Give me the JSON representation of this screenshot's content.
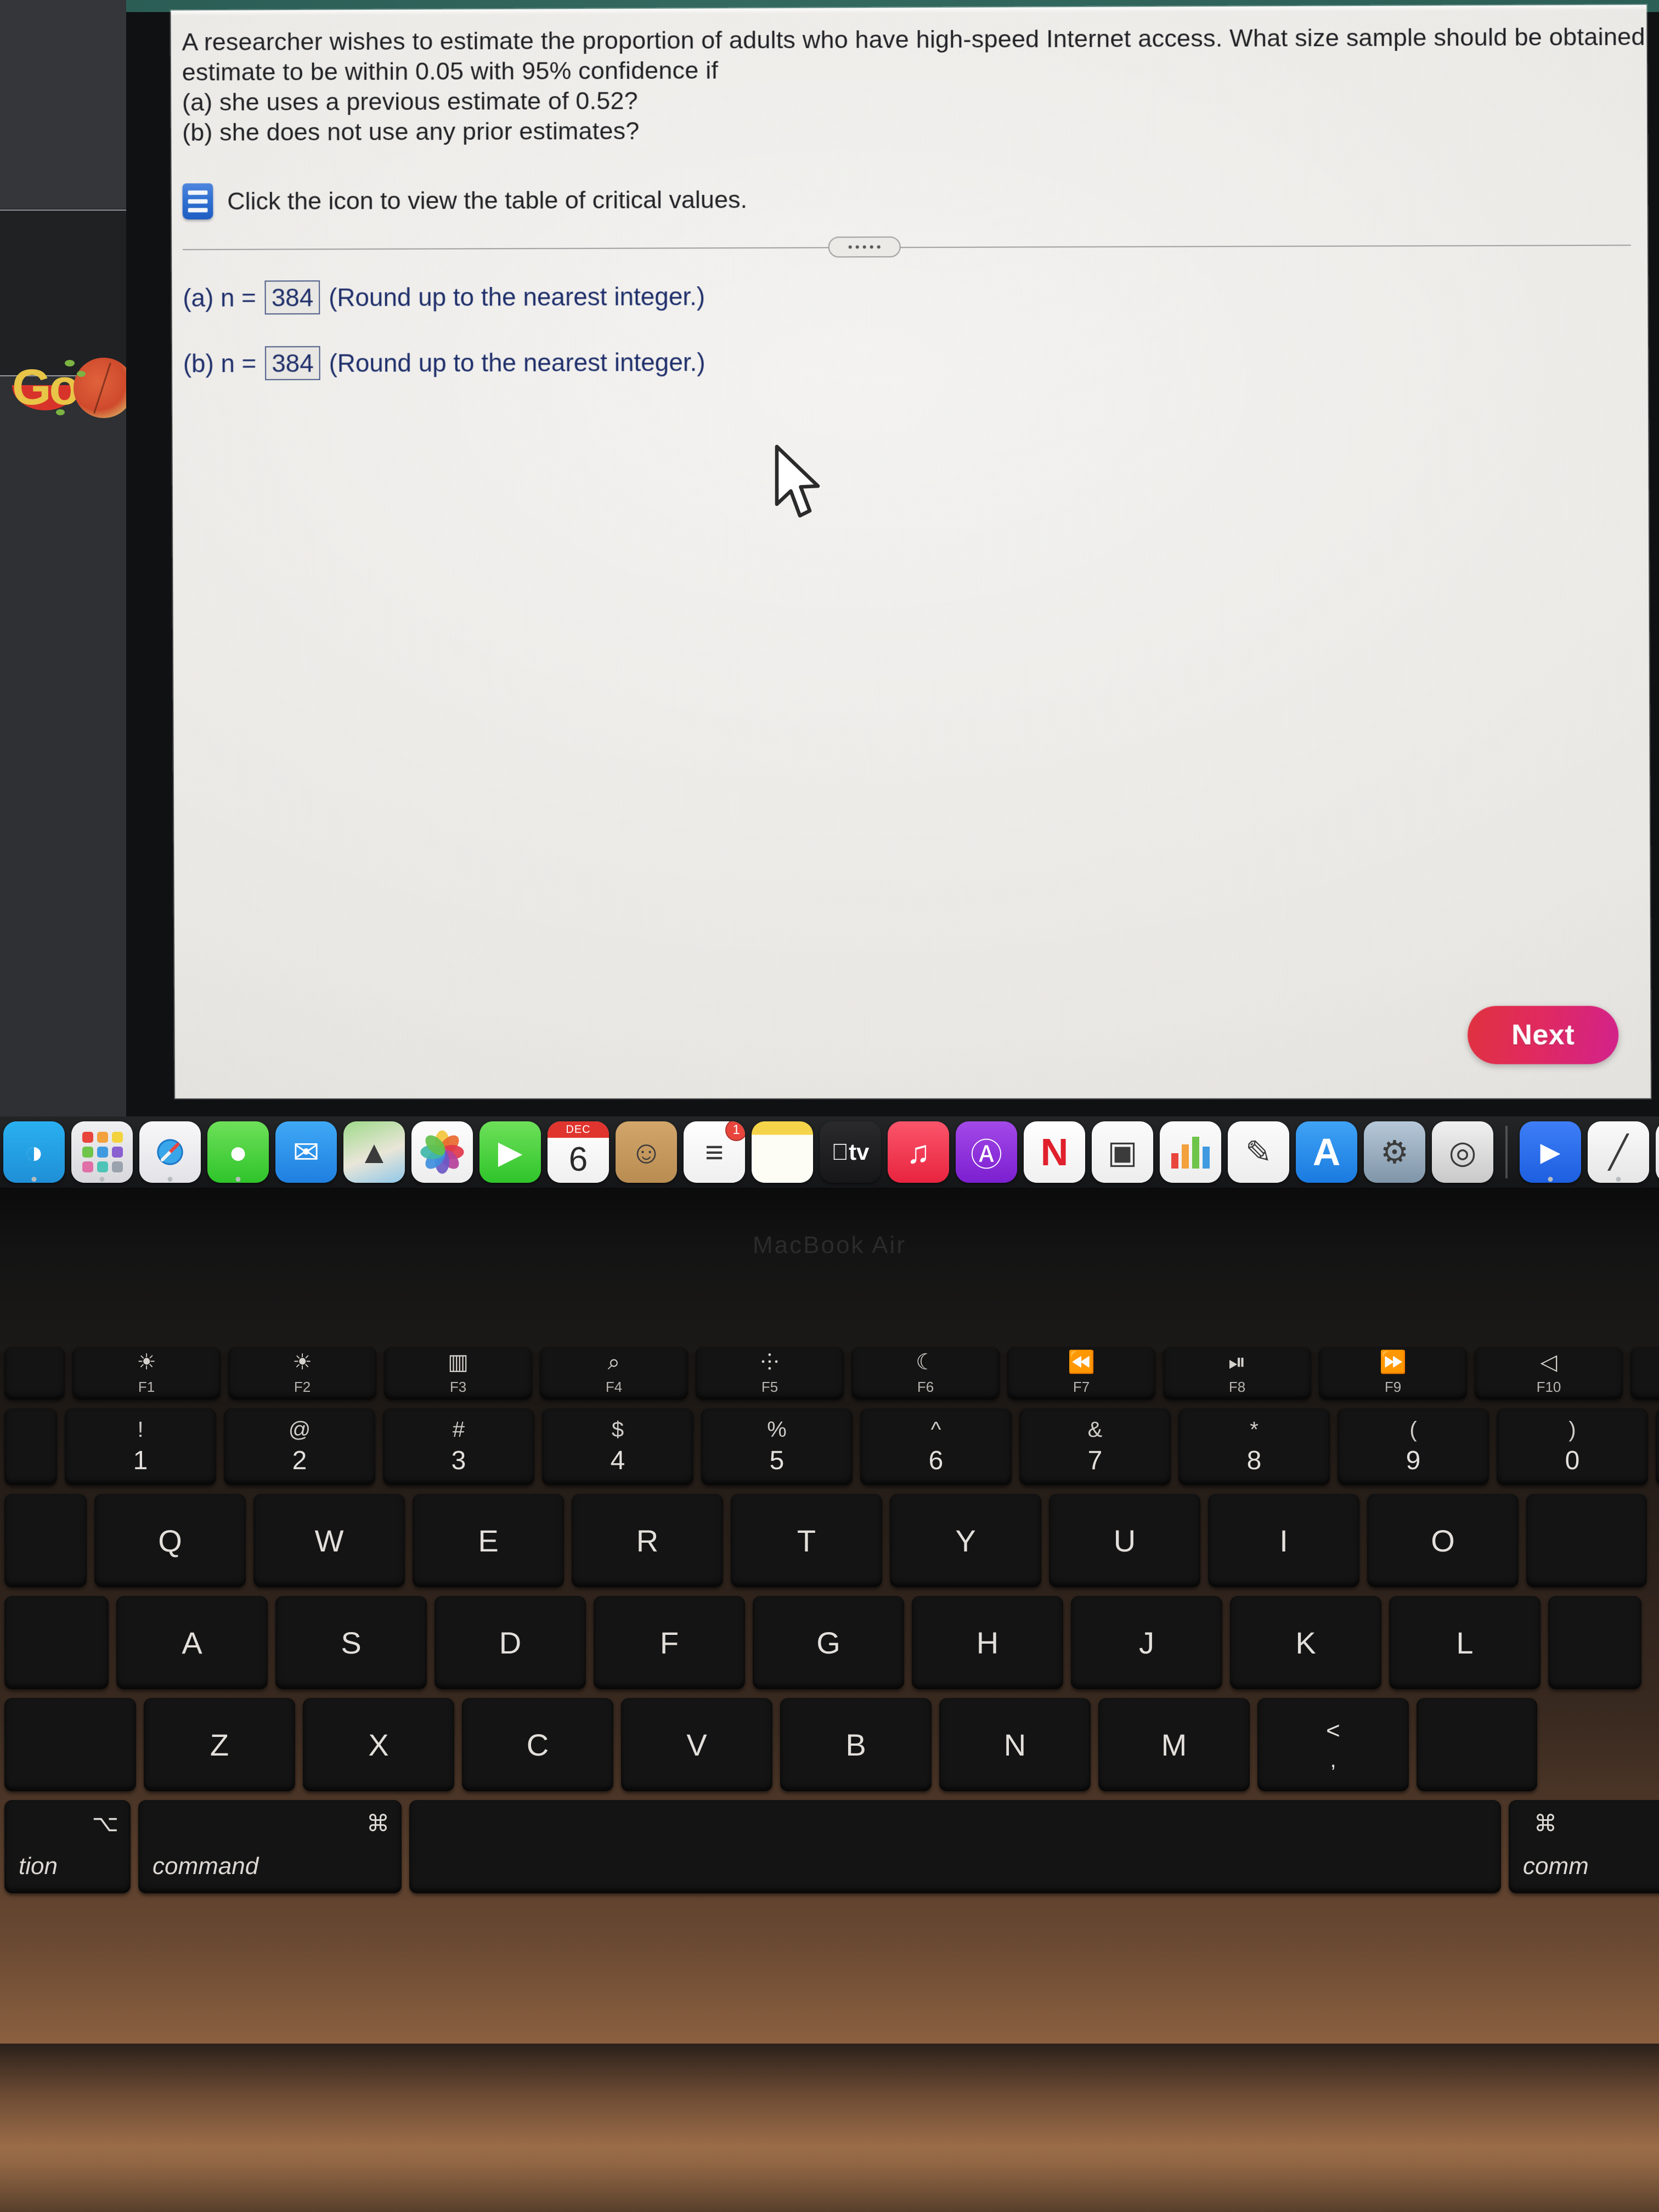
{
  "question": {
    "lines": [
      "A researcher wishes to estimate the proportion of adults who have high-speed Internet access. What size sample should be obtained if she wishes the",
      "estimate to be within 0.05 with 95% confidence if",
      "(a) she uses a previous estimate of 0.52?",
      "(b) she does not use any prior estimates?"
    ],
    "icon_hint": "Click the icon to view the table of critical values.",
    "divider_dots": "....."
  },
  "answers": [
    {
      "lead": "(a) n =",
      "value": "384",
      "tail": "(Round up to the nearest integer.)"
    },
    {
      "lead": "(b) n =",
      "value": "384",
      "tail": "(Round up to the nearest integer.)"
    }
  ],
  "next_button": {
    "label": "Next",
    "color": "#e02a5e"
  },
  "bg_window": {
    "logo_text": "Go"
  },
  "dock": {
    "items": [
      {
        "name": "finder",
        "glyph": "◑",
        "bg": "linear-gradient(180deg,#29b0f0,#1f8fd6)"
      },
      {
        "name": "launchpad",
        "glyph": "▓",
        "bg": "linear-gradient(180deg,#f0f0f2,#d8d8dc)"
      },
      {
        "name": "safari",
        "glyph": "✦",
        "bg": "linear-gradient(180deg,#f7f7f9,#e3e3e7)"
      },
      {
        "name": "messages",
        "glyph": "●",
        "bg": "linear-gradient(180deg,#6ee05a,#2fc42a)"
      },
      {
        "name": "mail",
        "glyph": "✉",
        "bg": "linear-gradient(180deg,#3fa9f5,#1f7fe0)"
      },
      {
        "name": "maps",
        "glyph": "▲",
        "bg": "linear-gradient(160deg,#9fd98a,#e9e6d8 55%,#8fc7e8)"
      },
      {
        "name": "photos",
        "glyph": "✿",
        "bg": "linear-gradient(180deg,#fdfdfd,#ededed)"
      },
      {
        "name": "facetime",
        "glyph": "▶",
        "bg": "linear-gradient(180deg,#6ee05a,#2fc42a)"
      },
      {
        "name": "calendar",
        "glyph": "6",
        "bg": "linear-gradient(180deg,#ffffff,#f0f0f0)",
        "top_label": "DEC"
      },
      {
        "name": "contacts",
        "glyph": "☺",
        "bg": "linear-gradient(180deg,#d2a66a,#b98c52)"
      },
      {
        "name": "reminders",
        "glyph": "≡",
        "bg": "linear-gradient(180deg,#ffffff,#efefef)",
        "badge": "1"
      },
      {
        "name": "notes",
        "glyph": "",
        "bg": "linear-gradient(180deg,#f6d44a 0 22%,#fdfdf6 22%)"
      },
      {
        "name": "appletv",
        "glyph": "tv",
        "bg": "linear-gradient(180deg,#2a2a2c,#171719)"
      },
      {
        "name": "music",
        "glyph": "♫",
        "bg": "linear-gradient(180deg,#fb556b,#e8243f)"
      },
      {
        "name": "podcasts",
        "glyph": "Ⓐ",
        "bg": "linear-gradient(180deg,#a349e8,#7b1fd0)"
      },
      {
        "name": "news",
        "glyph": "N",
        "bg": "linear-gradient(180deg,#ffffff,#f0f0f0)"
      },
      {
        "name": "keynote",
        "glyph": "▣",
        "bg": "linear-gradient(180deg,#fbfbfb,#ededed)"
      },
      {
        "name": "numbers",
        "glyph": "█",
        "bg": "linear-gradient(180deg,#fbfbfb,#ededed)"
      },
      {
        "name": "pages",
        "glyph": "✎",
        "bg": "linear-gradient(180deg,#fbfbfb,#ededed)"
      },
      {
        "name": "app-store",
        "glyph": "A",
        "bg": "linear-gradient(180deg,#3fa3f5,#1a7ae0)"
      },
      {
        "name": "system-preferences",
        "glyph": "⚙",
        "bg": "linear-gradient(180deg,#b6c8d8,#7f95a8)"
      },
      {
        "name": "siri",
        "glyph": "◎",
        "bg": "linear-gradient(180deg,#f0f0f0,#c9c9c9)"
      },
      {
        "name": "separator",
        "glyph": "",
        "bg": ""
      },
      {
        "name": "zoom",
        "glyph": "▶",
        "bg": "linear-gradient(180deg,#3e7ef7,#1c5fe0)"
      },
      {
        "name": "document",
        "glyph": "╱",
        "bg": "linear-gradient(180deg,#fafafa,#e6e6e6)"
      },
      {
        "name": "safari-window",
        "glyph": "✦",
        "bg": "linear-gradient(180deg,#f7f7f9,#e3e3e7)"
      }
    ]
  },
  "keyboard": {
    "fn_row": [
      {
        "sym": "☀",
        "lab": "F1"
      },
      {
        "sym": "☀",
        "lab": "F2"
      },
      {
        "sym": "▥",
        "lab": "F3"
      },
      {
        "sym": "⌕",
        "lab": "F4"
      },
      {
        "sym": "⸭",
        "lab": "F5"
      },
      {
        "sym": "☾",
        "lab": "F6"
      },
      {
        "sym": "⏪",
        "lab": "F7"
      },
      {
        "sym": "⏯",
        "lab": "F8"
      },
      {
        "sym": "⏩",
        "lab": "F9"
      },
      {
        "sym": "◁",
        "lab": "F10"
      }
    ],
    "num_row": [
      {
        "top": "!",
        "bot": "1"
      },
      {
        "top": "@",
        "bot": "2"
      },
      {
        "top": "#",
        "bot": "3"
      },
      {
        "top": "$",
        "bot": "4"
      },
      {
        "top": "%",
        "bot": "5"
      },
      {
        "top": "^",
        "bot": "6"
      },
      {
        "top": "&",
        "bot": "7"
      },
      {
        "top": "*",
        "bot": "8"
      },
      {
        "top": "(",
        "bot": "9"
      },
      {
        "top": ")",
        "bot": "0"
      }
    ],
    "row_q": [
      "Q",
      "W",
      "E",
      "R",
      "T",
      "Y",
      "U",
      "I",
      "O"
    ],
    "row_a": [
      "A",
      "S",
      "D",
      "F",
      "G",
      "H",
      "J",
      "K",
      "L"
    ],
    "row_z": [
      "Z",
      "X",
      "C",
      "V",
      "B",
      "N",
      "M"
    ],
    "row_z_extra": {
      "top": "<",
      "bot": ","
    },
    "bottom_row": {
      "option_left": "tion",
      "option_glyph": "⌥",
      "command_left": "command",
      "command_glyph": "⌘",
      "command_right": "comm",
      "command_right_glyph": "⌘"
    }
  }
}
